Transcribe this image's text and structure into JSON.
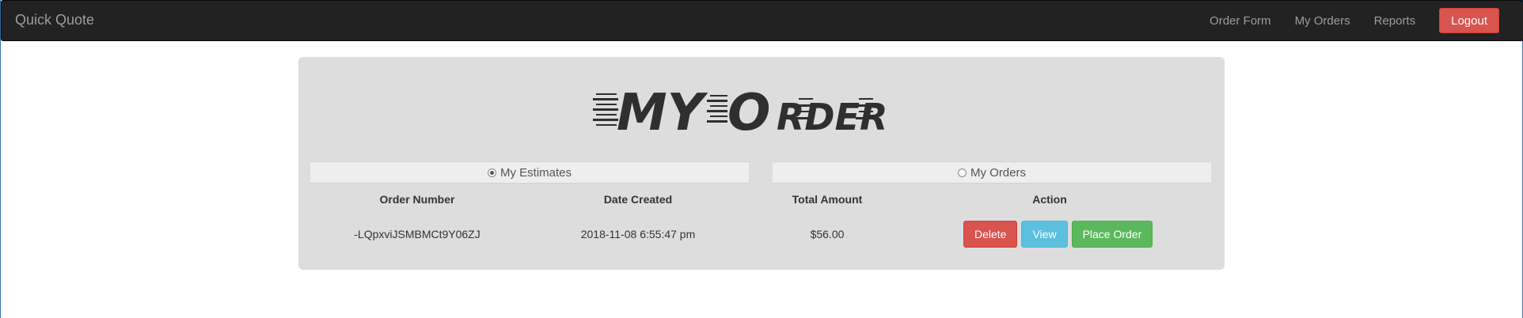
{
  "navbar": {
    "brand": "Quick Quote",
    "links": [
      "Order Form",
      "My Orders",
      "Reports"
    ],
    "logout_label": "Logout"
  },
  "panel": {
    "logo_text": "MY ORDER",
    "toggles": {
      "estimates_label": "My Estimates",
      "estimates_selected": true,
      "orders_label": "My Orders",
      "orders_selected": false
    },
    "table": {
      "headers": [
        "Order Number",
        "Date Created",
        "Total Amount",
        "Action"
      ],
      "rows": [
        {
          "order_number": "-LQpxviJSMBMCt9Y06ZJ",
          "date_created": "2018-11-08 6:55:47 pm",
          "total_amount": "$56.00",
          "actions": [
            "Delete",
            "View",
            "Place Order"
          ]
        }
      ]
    }
  },
  "colors": {
    "navbar_bg": "#222222",
    "panel_bg": "#dddddd",
    "danger": "#d9534f",
    "info": "#5bc0de",
    "success": "#5cb85c"
  }
}
